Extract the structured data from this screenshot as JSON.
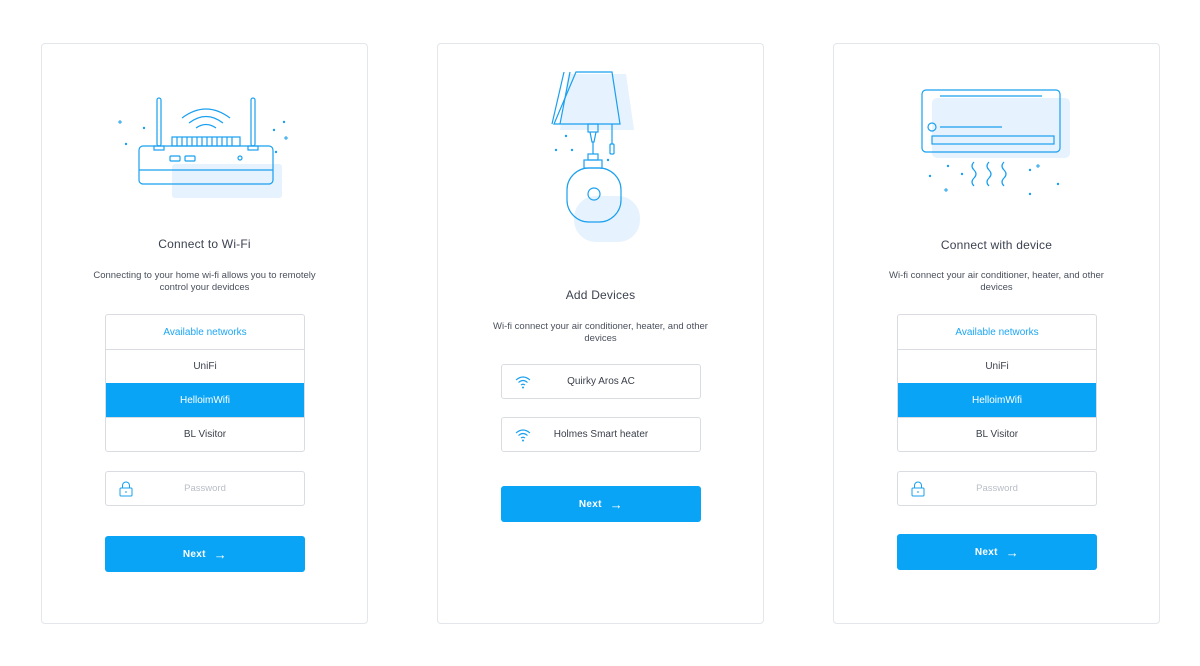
{
  "colors": {
    "accent": "#0aa4f6",
    "border": "#d9dde2",
    "illustration_fill": "#e6f2fd"
  },
  "cards": [
    {
      "illustration": "router-icon",
      "title": "Connect to Wi-Fi",
      "description": "Connecting to your home wi-fi allows you to remotely control your devidces",
      "networks": {
        "header": "Available networks",
        "items": [
          "UniFi",
          "HelloimWifi",
          "BL Visitor"
        ],
        "selected": "HelloimWifi"
      },
      "password_placeholder": "Password",
      "next_label": "Next",
      "next_icon": "arrow-right-icon"
    },
    {
      "illustration": "lamp-icon",
      "title": "Add Devices",
      "description": "Wi-fi connect your air conditioner, heater, and other devices",
      "devices": [
        "Quirky Aros AC",
        "Holmes Smart heater"
      ],
      "device_icon": "wifi-icon",
      "next_label": "Next",
      "next_icon": "arrow-right-icon"
    },
    {
      "illustration": "air-conditioner-icon",
      "title": "Connect with device",
      "description": "Wi-fi connect your air conditioner, heater, and other devices",
      "networks": {
        "header": "Available networks",
        "items": [
          "UniFi",
          "HelloimWifi",
          "BL Visitor"
        ],
        "selected": "HelloimWifi"
      },
      "password_placeholder": "Password",
      "next_label": "Next",
      "next_icon": "arrow-right-icon"
    }
  ]
}
